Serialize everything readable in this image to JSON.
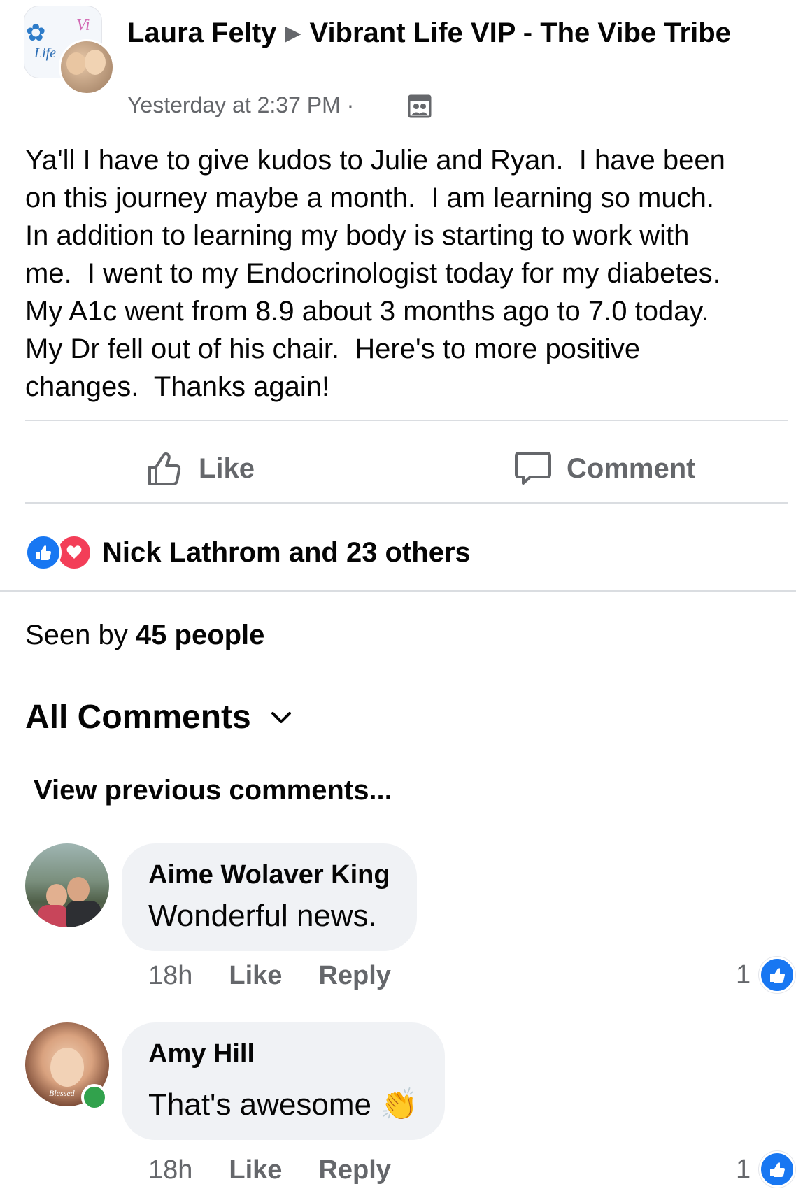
{
  "post": {
    "author": "Laura Felty",
    "group": "Vibrant Life VIP - The Vibe Tribe",
    "group_avatar_text": "Life",
    "timestamp": "Yesterday at 2:37 PM ·",
    "body": "Ya'll I have to give kudos to Julie and Ryan.  I have been\non this journey maybe a month.  I am learning so much.\nIn addition to learning my body is starting to work with\nme.  I went to my Endocrinologist today for my diabetes.\nMy A1c went from 8.9 about 3 months ago to 7.0 today.\nMy Dr fell out of his chair.  Here's to more positive\nchanges.  Thanks again!",
    "privacy_icon": "group-members-icon"
  },
  "actions": {
    "like_label": "Like",
    "comment_label": "Comment"
  },
  "reactions": {
    "summary": "Nick Lathrom and 23 others",
    "types": [
      "like",
      "love"
    ]
  },
  "seen": {
    "prefix": "Seen by",
    "count": "45 people"
  },
  "comments_header": {
    "sort_label": "All Comments",
    "view_previous": "View previous comments..."
  },
  "comments": [
    {
      "name": "Aime Wolaver King",
      "text": "Wonderful news.",
      "time": "18h",
      "like_label": "Like",
      "reply_label": "Reply",
      "reaction_count": "1"
    },
    {
      "name": "Amy Hill",
      "text": "That's awesome 👏",
      "time": "18h",
      "like_label": "Like",
      "reply_label": "Reply",
      "reaction_count": "1",
      "avatar_text": "Blessed"
    }
  ],
  "colors": {
    "facebook_blue": "#1877f2",
    "love_red": "#f33e58",
    "secondary_text": "#65676b",
    "bubble_bg": "#f0f2f5",
    "online_green": "#31a24c"
  }
}
